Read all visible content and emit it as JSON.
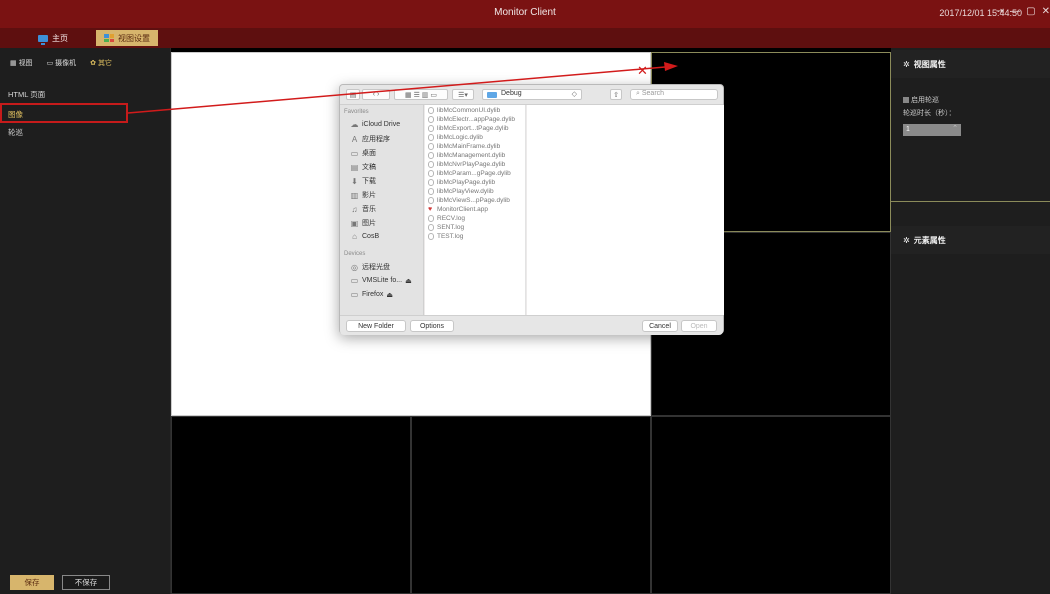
{
  "window": {
    "title": "Monitor Client",
    "clock": "2017/12/01 15:44:50",
    "controls": [
      "⇥",
      "—",
      "▢",
      "✕"
    ]
  },
  "nav": {
    "home": "主页",
    "view_settings": "视图设置"
  },
  "left": {
    "tabs": [
      "视图",
      "摄像机",
      "其它"
    ],
    "items": [
      "HTML 页面",
      "图像",
      "轮巡"
    ],
    "save": "保存",
    "nosave": "不保存"
  },
  "grid": {
    "close": "✕"
  },
  "right": {
    "view_props": "视图属性",
    "enable_patrol": "启用轮巡",
    "patrol_duration": "轮巡时长（秒）：",
    "duration_value": "1",
    "element_props": "元素属性"
  },
  "dialog": {
    "folder": "Debug",
    "search_placeholder": "Search",
    "favorites_head": "Favorites",
    "favorites": [
      {
        "icon": "cloud-icon",
        "label": "iCloud Drive"
      },
      {
        "icon": "apps-icon",
        "label": "应用程序"
      },
      {
        "icon": "desktop-icon",
        "label": "桌面"
      },
      {
        "icon": "documents-icon",
        "label": "文稿"
      },
      {
        "icon": "download-icon",
        "label": "下载"
      },
      {
        "icon": "movies-icon",
        "label": "影片"
      },
      {
        "icon": "music-icon",
        "label": "音乐"
      },
      {
        "icon": "pictures-icon",
        "label": "图片"
      },
      {
        "icon": "home-icon",
        "label": "CosB"
      }
    ],
    "devices_head": "Devices",
    "devices": [
      {
        "icon": "disc-icon",
        "label": "远程光盘"
      },
      {
        "icon": "drive-icon",
        "label": "VMSLite fo..."
      },
      {
        "icon": "drive-icon",
        "label": "Firefox"
      }
    ],
    "files": [
      "libMcCommonUI.dylib",
      "libMcElectr...appPage.dylib",
      "libMcExport...tPage.dylib",
      "libMcLogic.dylib",
      "libMcMainFrame.dylib",
      "libMcManagement.dylib",
      "libMcNvrPlayPage.dylib",
      "libMcParam...gPage.dylib",
      "libMcPlayPage.dylib",
      "libMcPlayView.dylib",
      "libMcViewS...pPage.dylib",
      "MonitorClient.app",
      "RECV.log",
      "SENT.log",
      "TEST.log"
    ],
    "new_folder": "New Folder",
    "options": "Options",
    "cancel": "Cancel",
    "open": "Open"
  },
  "colors": {
    "titlebar": "#7a1212",
    "accent_gold": "#d7b56c",
    "selection_red": "#c61b1b",
    "highlight_yellow": "#e0c060"
  }
}
